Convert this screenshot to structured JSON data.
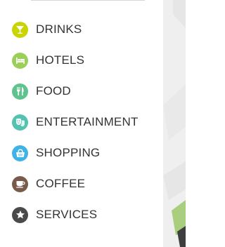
{
  "legend": {
    "items": [
      {
        "key": "drinks",
        "label": "DRINKS",
        "icon": "cocktail-glass-icon",
        "color": "#c9d400"
      },
      {
        "key": "hotels",
        "label": "HOTELS",
        "icon": "bed-icon",
        "color": "#9bcf5a"
      },
      {
        "key": "food",
        "label": "FOOD",
        "icon": "fork-knife-icon",
        "color": "#5fc38d"
      },
      {
        "key": "entertainment",
        "label": "ENTERTAINMENT",
        "icon": "theater-masks-icon",
        "color": "#52c2b1"
      },
      {
        "key": "shopping",
        "label": "SHOPPING",
        "icon": "shopping-basket-icon",
        "color": "#3fb3e6"
      },
      {
        "key": "coffee",
        "label": "COFFEE",
        "icon": "coffee-cup-icon",
        "color": "#7a5a4a"
      },
      {
        "key": "services",
        "label": "SERVICES",
        "icon": "star-icon",
        "color": "#4a4a4a"
      }
    ]
  },
  "colors": {
    "label_text": "#333333",
    "map_land": "#efefef",
    "map_road": "#ffffff",
    "map_park": "#a9cf7e",
    "map_dark": "#3e3e3e"
  }
}
